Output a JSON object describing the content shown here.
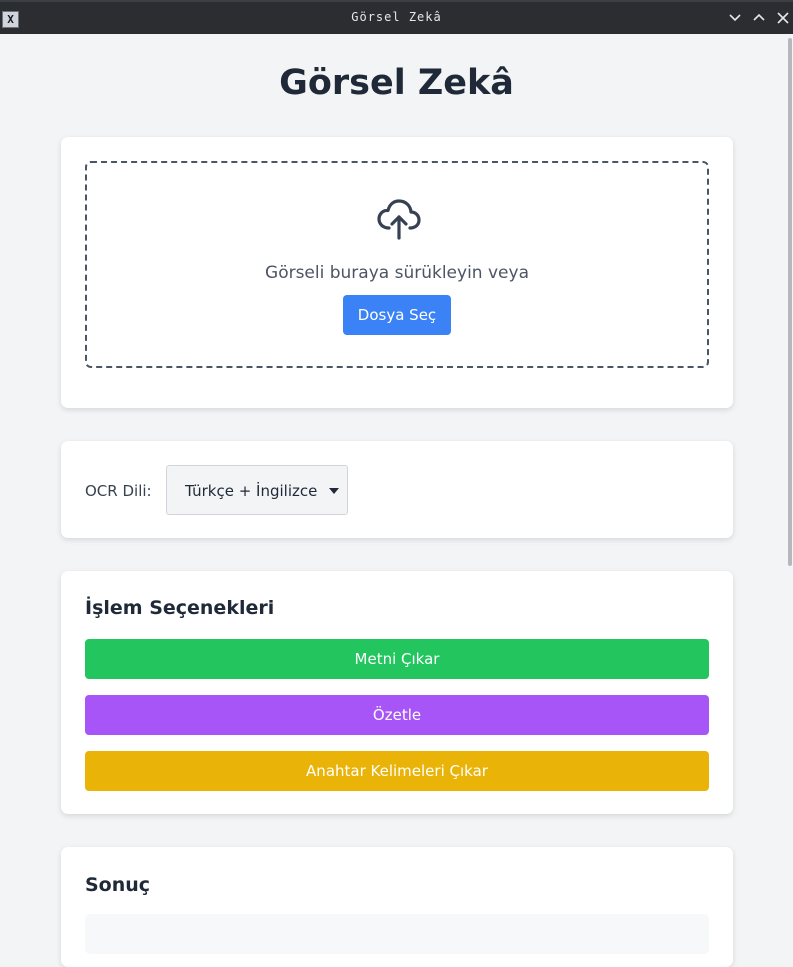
{
  "window": {
    "title": "Görsel Zekâ"
  },
  "page": {
    "title": "Görsel Zekâ"
  },
  "upload": {
    "prompt": "Görseli buraya sürükleyin veya",
    "button_label": "Dosya Seç",
    "icon": "cloud-upload-icon"
  },
  "ocr": {
    "label": "OCR Dili:",
    "selected": "Türkçe + İngilizce"
  },
  "actions": {
    "title": "İşlem Seçenekleri",
    "buttons": [
      {
        "label": "Metni Çıkar",
        "color": "#22c55e"
      },
      {
        "label": "Özetle",
        "color": "#a855f7"
      },
      {
        "label": "Anahtar Kelimeleri Çıkar",
        "color": "#eab308"
      }
    ]
  },
  "result": {
    "title": "Sonuç"
  }
}
